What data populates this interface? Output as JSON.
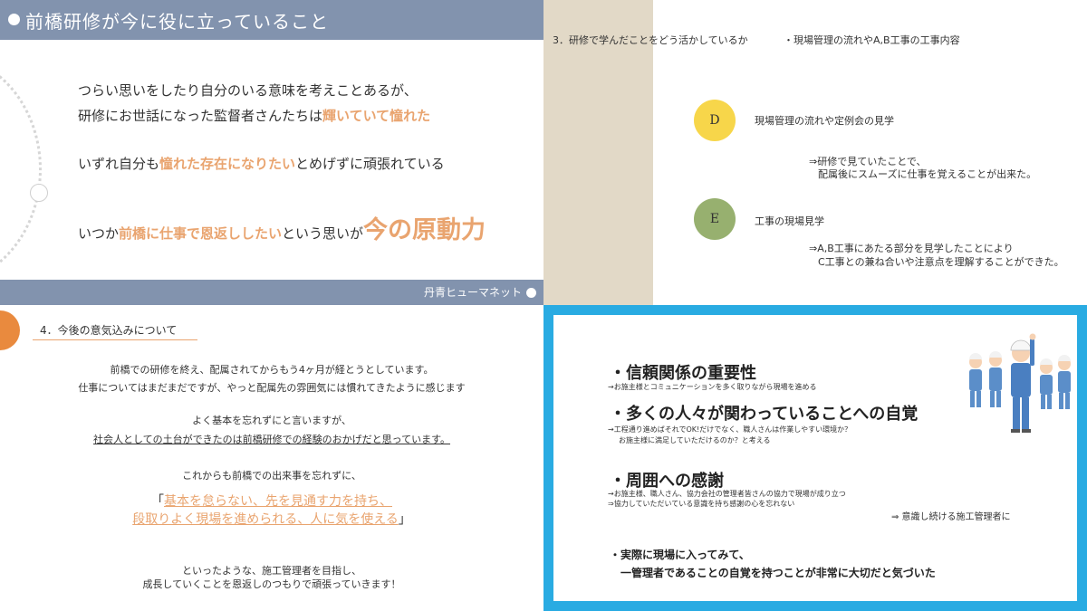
{
  "tl": {
    "title": "前橋研修が今に役に立っていること",
    "line1": "つらい思いをしたり自分のいる意味を考えことあるが、",
    "line2a": "研修にお世話になった監督者さんたちは",
    "line2b": "輝いていて憧れた",
    "line3a": "いずれ自分も",
    "line3b": "憧れた存在になりたい",
    "line3c": "とめげずに頑張れている",
    "line4a": "いつか",
    "line4b": "前橋に仕事で恩返ししたい",
    "line4c": "という思いが",
    "line4d": "今の原動力",
    "footer": "丹青ヒューマネット"
  },
  "tr": {
    "heading": "3．研修で学んだことをどう活かしているか",
    "heading2": "・現場管理の流れやA,B工事の工事内容",
    "d_letter": "D",
    "d_title": "現場管理の流れや定例会の見学",
    "d_sub1": "⇒研修で見ていたことで、",
    "d_sub2": "配属後にスムーズに仕事を覚えることが出来た。",
    "e_letter": "E",
    "e_title": "工事の現場見学",
    "e_sub1": "⇒A,B工事にあたる部分を見学したことにより",
    "e_sub2": "C工事との兼ね合いや注意点を理解することができた。",
    "colors": {
      "d": "#f7d64a",
      "e": "#97b06f",
      "beige": "#e2d9c7"
    }
  },
  "bl": {
    "heading": "4．今後の意気込みについて",
    "p1": "前橋での研修を終え、配属されてからもう4ヶ月が経とうとしています。",
    "p2": "仕事についてはまだまだですが、やっと配属先の雰囲気には慣れてきたように感じます",
    "p3": "よく基本を忘れずにと言いますが、",
    "p4": "社会人としての土台ができたのは前橋研修での経験のおかげだと思っています。",
    "p5": "これからも前橋での出来事を忘れずに、",
    "q1_open": "「",
    "q1": "基本を怠らない、先を見通す力を持ち、",
    "q2": "段取りよく現場を進められる、人に気を使える",
    "q2_close": "」",
    "p6": "といったような、施工管理者を目指し、",
    "p7": "成長していくことを恩返しのつもりで頑張っていきます！"
  },
  "br": {
    "h1": "・信頼関係の重要性",
    "s1": "→お施主様とコミュニケーションを多く取りながら現場を進める",
    "h2": "・多くの人々が関わっていることへの自覚",
    "s2a": "→工程通り進めばそれでOK!だけでなく、職人さんは作業しやすい環境か？",
    "s2b": "お施主様に満足していただけるのか？と考える",
    "h3": "・周囲への感謝",
    "s3a": "→お施主様、職人さん、協力会社の管理者皆さんの協力で現場が成り立つ",
    "s3b": "⇒協力していただいている意識を持ち感謝の心を忘れない",
    "m3": "⇒ 意識し続ける施工管理者に",
    "h4a": "・実際に現場に入ってみて、",
    "h4b": "一管理者であることの自覚を持つことが非常に大切だと気づいた",
    "colors": {
      "frame": "#29abe2"
    }
  }
}
